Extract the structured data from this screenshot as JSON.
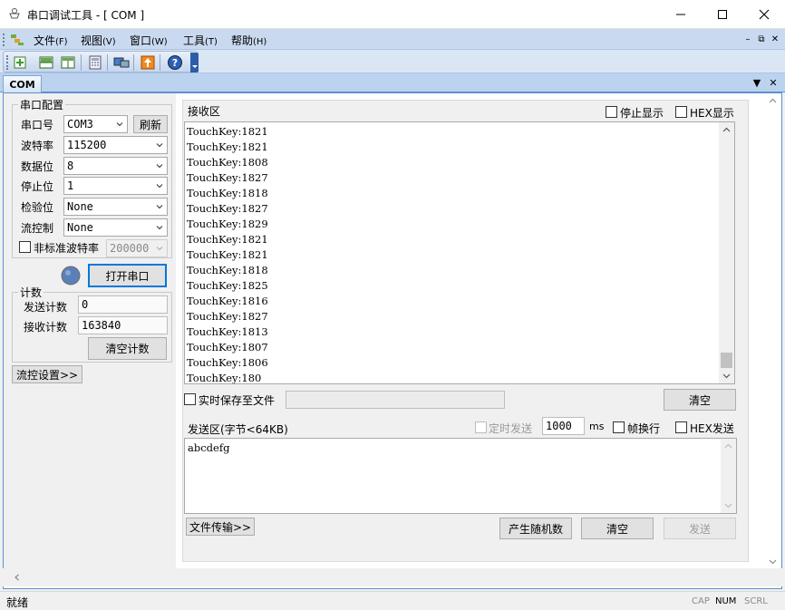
{
  "window": {
    "title": "串口调试工具 - [ COM ]"
  },
  "menu": [
    {
      "label": "文件",
      "key": "(F)"
    },
    {
      "label": "视图",
      "key": "(V)"
    },
    {
      "label": "窗口",
      "key": "(W)"
    },
    {
      "label": "工具",
      "key": "(T)"
    },
    {
      "label": "帮助",
      "key": "(H)"
    }
  ],
  "doc_tab": "COM",
  "serial_config": {
    "title": "串口配置",
    "port": {
      "label": "串口号",
      "value": "COM3"
    },
    "refresh_label": "刷新",
    "baud": {
      "label": "波特率",
      "value": "115200"
    },
    "data_bits": {
      "label": "数据位",
      "value": "8"
    },
    "stop_bits": {
      "label": "停止位",
      "value": "1"
    },
    "parity": {
      "label": "检验位",
      "value": "None"
    },
    "flow": {
      "label": "流控制",
      "value": "None"
    },
    "nonstd": {
      "label": "非标准波特率",
      "value": "200000",
      "checked": false
    },
    "open_label": "打开串口"
  },
  "count": {
    "title": "计数",
    "send": {
      "label": "发送计数",
      "value": "0"
    },
    "recv": {
      "label": "接收计数",
      "value": "163840"
    },
    "clear_label": "清空计数"
  },
  "flow_settings_label": "流控设置>>",
  "receive": {
    "title": "接收区",
    "stop_display": "停止显示",
    "hex_display": "HEX显示",
    "lines": [
      "TouchKey:1821",
      "TouchKey:1821",
      "TouchKey:1808",
      "TouchKey:1827",
      "TouchKey:1818",
      "TouchKey:1827",
      "TouchKey:1829",
      "TouchKey:1821",
      "TouchKey:1821",
      "TouchKey:1818",
      "TouchKey:1825",
      "TouchKey:1816",
      "TouchKey:1827",
      "TouchKey:1813",
      "TouchKey:1807",
      "TouchKey:1806",
      "TouchKey:180"
    ],
    "save_label": "实时保存至文件",
    "save_path": "",
    "clear_label": "清空"
  },
  "send": {
    "title": "发送区(字节<64KB)",
    "timed_label": "定时发送",
    "interval": "1000",
    "unit": "ms",
    "frame_label": "帧换行",
    "hex_send": "HEX发送",
    "text": "abcdefg",
    "file_transfer_label": "文件传输>>",
    "random_label": "产生随机数",
    "clear_label": "清空",
    "send_label": "发送"
  },
  "status": {
    "ready": "就绪",
    "cap": "CAP",
    "num": "NUM",
    "scrl": "SCRL"
  },
  "colors": {
    "menubar": "#c9daf0",
    "accent": "#0078d7",
    "led": "#5b7fb8"
  }
}
